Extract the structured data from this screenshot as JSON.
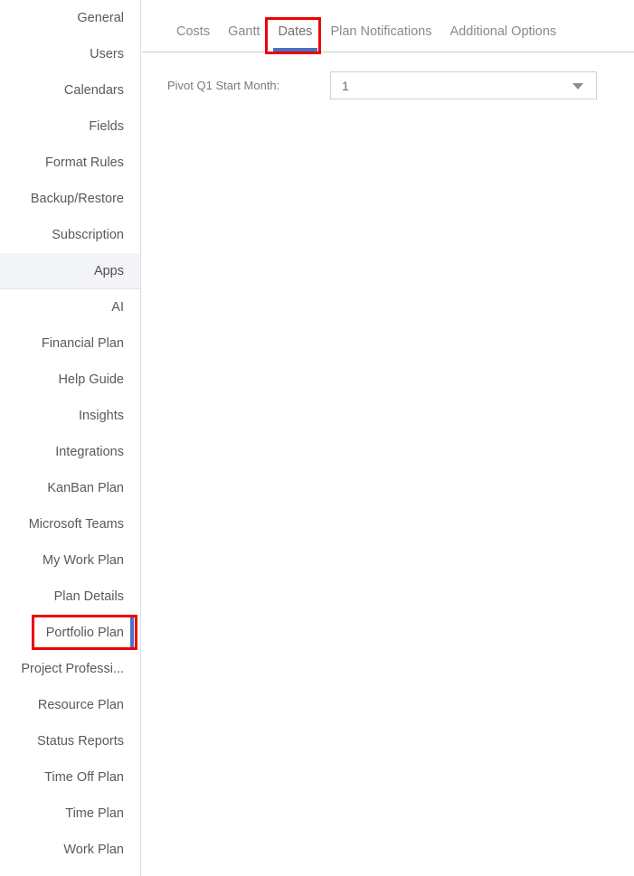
{
  "sidebar": {
    "items": [
      {
        "label": "General",
        "state": "normal"
      },
      {
        "label": "Users",
        "state": "normal"
      },
      {
        "label": "Calendars",
        "state": "normal"
      },
      {
        "label": "Fields",
        "state": "normal"
      },
      {
        "label": "Format Rules",
        "state": "normal"
      },
      {
        "label": "Backup/Restore",
        "state": "normal"
      },
      {
        "label": "Subscription",
        "state": "normal"
      },
      {
        "label": "Apps",
        "state": "active"
      },
      {
        "label": "AI",
        "state": "normal"
      },
      {
        "label": "Financial Plan",
        "state": "normal"
      },
      {
        "label": "Help Guide",
        "state": "normal"
      },
      {
        "label": "Insights",
        "state": "normal"
      },
      {
        "label": "Integrations",
        "state": "normal"
      },
      {
        "label": "KanBan Plan",
        "state": "normal"
      },
      {
        "label": "Microsoft Teams",
        "state": "normal"
      },
      {
        "label": "My Work Plan",
        "state": "normal"
      },
      {
        "label": "Plan Details",
        "state": "normal"
      },
      {
        "label": "Portfolio Plan",
        "state": "selected"
      },
      {
        "label": "Project Professi...",
        "state": "normal"
      },
      {
        "label": "Resource Plan",
        "state": "normal"
      },
      {
        "label": "Status Reports",
        "state": "normal"
      },
      {
        "label": "Time Off Plan",
        "state": "normal"
      },
      {
        "label": "Time Plan",
        "state": "normal"
      },
      {
        "label": "Work Plan",
        "state": "normal"
      }
    ]
  },
  "tabs": [
    {
      "label": "Costs",
      "active": false
    },
    {
      "label": "Gantt",
      "active": false
    },
    {
      "label": "Dates",
      "active": true
    },
    {
      "label": "Plan Notifications",
      "active": false
    },
    {
      "label": "Additional Options",
      "active": false
    }
  ],
  "form": {
    "pivot_q1_start_month": {
      "label": "Pivot Q1 Start Month:",
      "value": "1",
      "arrow_icon": "chevron-down-icon"
    }
  },
  "annotations": {
    "color": "#ee0000",
    "sidebar_target": "Portfolio Plan",
    "tab_target": "Dates"
  },
  "colors": {
    "accent": "#4a72c4",
    "active_row_bg": "#f3f4f7",
    "text": "#5a5a5a",
    "muted_text": "#8a8a8a",
    "border": "#cfcfcf",
    "annotation": "#ee0000"
  }
}
